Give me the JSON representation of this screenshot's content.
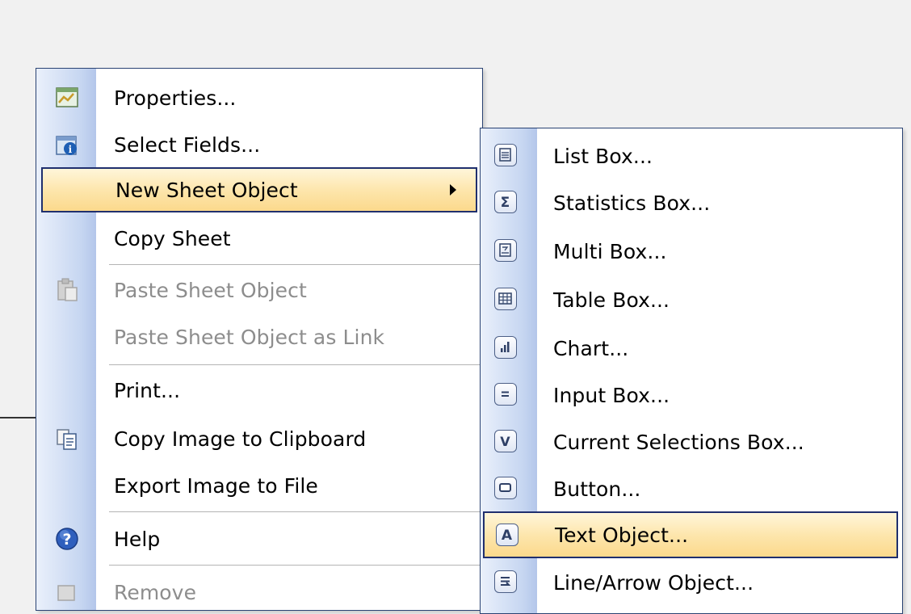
{
  "context_menu": {
    "items": [
      {
        "label": "Properties...",
        "icon": "properties-icon",
        "enabled": true
      },
      {
        "label": "Select Fields...",
        "icon": "select-fields-icon",
        "enabled": true
      },
      {
        "label": "New Sheet Object",
        "icon": "",
        "enabled": true,
        "submenu": true,
        "highlighted": true
      },
      {
        "label": "Copy Sheet",
        "icon": "",
        "enabled": true
      },
      {
        "label": "Paste Sheet Object",
        "icon": "paste-icon",
        "enabled": false
      },
      {
        "label": "Paste Sheet Object as Link",
        "icon": "",
        "enabled": false
      },
      {
        "label": "Print...",
        "icon": "",
        "enabled": true
      },
      {
        "label": "Copy Image to Clipboard",
        "icon": "copy-image-icon",
        "enabled": true
      },
      {
        "label": "Export Image to File",
        "icon": "",
        "enabled": true
      },
      {
        "label": "Help",
        "icon": "help-icon",
        "enabled": true
      },
      {
        "label": "Remove",
        "icon": "remove-icon",
        "enabled": false
      }
    ]
  },
  "submenu": {
    "items": [
      {
        "label": "List Box...",
        "icon": "list-box-icon"
      },
      {
        "label": "Statistics Box...",
        "icon": "statistics-box-icon"
      },
      {
        "label": "Multi Box...",
        "icon": "multi-box-icon"
      },
      {
        "label": "Table Box...",
        "icon": "table-box-icon"
      },
      {
        "label": "Chart...",
        "icon": "chart-icon"
      },
      {
        "label": "Input Box...",
        "icon": "input-box-icon"
      },
      {
        "label": "Current Selections Box...",
        "icon": "current-selections-icon"
      },
      {
        "label": "Button...",
        "icon": "button-icon"
      },
      {
        "label": "Text Object...",
        "icon": "text-object-icon",
        "highlighted": true
      },
      {
        "label": "Line/Arrow Object...",
        "icon": "line-arrow-icon"
      }
    ]
  },
  "colors": {
    "menu_border": "#2a4373",
    "highlight_fill": "#fde6ad",
    "highlight_border": "#1f2f6e",
    "gutter": "#c6d6f1",
    "disabled_text": "#8d8d8d"
  }
}
